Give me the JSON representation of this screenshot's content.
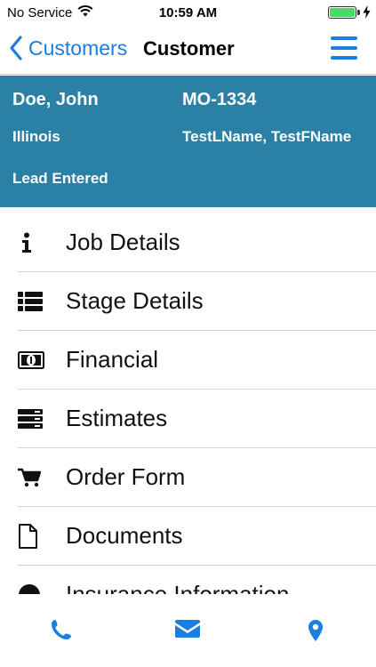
{
  "status_bar": {
    "carrier": "No Service",
    "time": "10:59 AM",
    "battery_level": 1.0,
    "battery_color": "#4cd964"
  },
  "nav": {
    "back_label": "Customers",
    "title": "Customer",
    "accent_color": "#1a7de0"
  },
  "customer": {
    "name": "Doe, John",
    "id": "MO-1334",
    "state": "Illinois",
    "contact": "TestLName, TestFName",
    "status": "Lead Entered",
    "header_color": "#2a80a5"
  },
  "menu": {
    "items": [
      {
        "label": "Job Details",
        "icon": "info-icon"
      },
      {
        "label": "Stage Details",
        "icon": "list-icon"
      },
      {
        "label": "Financial",
        "icon": "money-icon"
      },
      {
        "label": "Estimates",
        "icon": "server-icon"
      },
      {
        "label": "Order Form",
        "icon": "cart-icon"
      },
      {
        "label": "Documents",
        "icon": "file-icon"
      },
      {
        "label": "Insurance Information",
        "icon": "umbrella-icon"
      }
    ]
  },
  "tab_bar": {
    "items": [
      {
        "icon": "phone-icon"
      },
      {
        "icon": "mail-icon"
      },
      {
        "icon": "location-pin-icon"
      }
    ]
  }
}
